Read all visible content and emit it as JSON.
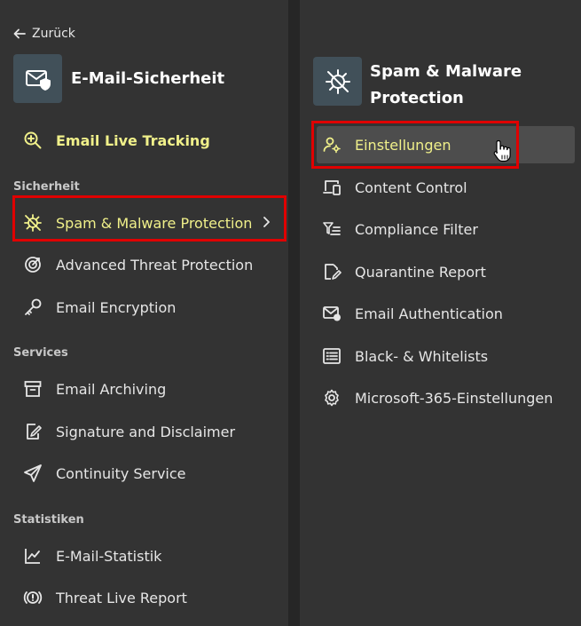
{
  "back": {
    "label": "Zurück",
    "icon": "arrow-left-icon"
  },
  "left": {
    "title": "E-Mail-Sicherheit",
    "title_icon": "mail-shield-icon",
    "live_tracking": "Email Live Tracking",
    "groups": [
      {
        "label": "Sicherheit",
        "items": [
          "Spam & Malware Protection",
          "Advanced Threat Protection",
          "Email Encryption"
        ]
      },
      {
        "label": "Services",
        "items": [
          "Email Archiving",
          "Signature and Disclaimer",
          "Continuity Service"
        ]
      },
      {
        "label": "Statistiken",
        "items": [
          "E-Mail-Statistik",
          "Threat Live Report"
        ]
      }
    ]
  },
  "right": {
    "title_line1": "Spam & Malware",
    "title_line2": "Protection",
    "title_icon": "virus-slash-icon",
    "items": [
      "Einstellungen",
      "Content Control",
      "Compliance Filter",
      "Quarantine Report",
      "Email Authentication",
      "Black- & Whitelists",
      "Microsoft-365-Einstellungen"
    ]
  },
  "colors": {
    "accent_yellow": "#f0f08a",
    "highlight_red": "#e00000",
    "panel": "#333333",
    "tile": "#415059"
  }
}
